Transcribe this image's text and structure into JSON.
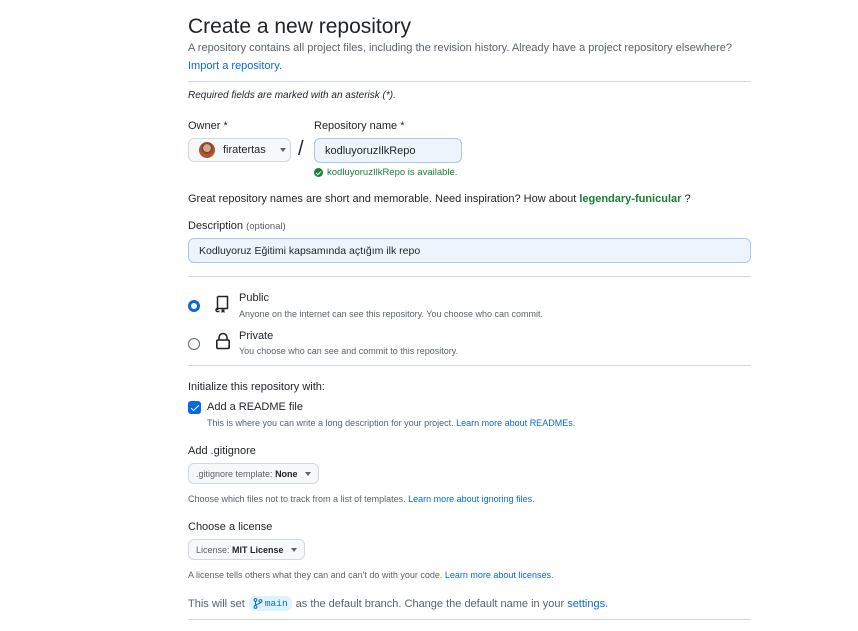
{
  "header": {
    "title": "Create a new repository",
    "subtitle": "A repository contains all project files, including the revision history. Already have a project repository elsewhere?",
    "import_link": "Import a repository."
  },
  "required_note": "Required fields are marked with an asterisk (*).",
  "owner": {
    "label": "Owner *",
    "value": "firatertas"
  },
  "repo_name": {
    "label": "Repository name *",
    "value": "kodluyoruzIlkRepo",
    "availability": "kodluyoruzIlkRepo is available."
  },
  "suggestion": {
    "text": "Great repository names are short and memorable. Need inspiration? How about",
    "name": "legendary-funicular",
    "end": "?"
  },
  "description": {
    "label": "Description",
    "optional": "(optional)",
    "value": "Kodluyoruz Eğitimi kapsamında açtığım ilk repo"
  },
  "visibility": {
    "selected": "public",
    "public": {
      "title": "Public",
      "desc": "Anyone on the internet can see this repository. You choose who can commit."
    },
    "private": {
      "title": "Private",
      "desc": "You choose who can see and commit to this repository."
    }
  },
  "initialize": {
    "title": "Initialize this repository with:",
    "readme": {
      "label": "Add a README file",
      "checked": true,
      "desc": "This is where you can write a long description for your project.",
      "link": "Learn more about READMEs."
    }
  },
  "gitignore": {
    "title": "Add .gitignore",
    "prefix": ".gitignore template:",
    "value": "None",
    "desc": "Choose which files not to track from a list of templates.",
    "link": "Learn more about ignoring files."
  },
  "license": {
    "title": "Choose a license",
    "prefix": "License:",
    "value": "MIT License",
    "desc": "A license tells others what they can and can't do with your code.",
    "link": "Learn more about licenses."
  },
  "branch": {
    "prefix": "This will set",
    "name": "main",
    "middle": "as the default branch. Change the default name in your",
    "link": "settings",
    "end": "."
  },
  "colors": {
    "accent": "#0969da",
    "success": "#1a7f37",
    "muted": "#59636e",
    "border": "#d1d9e0"
  }
}
